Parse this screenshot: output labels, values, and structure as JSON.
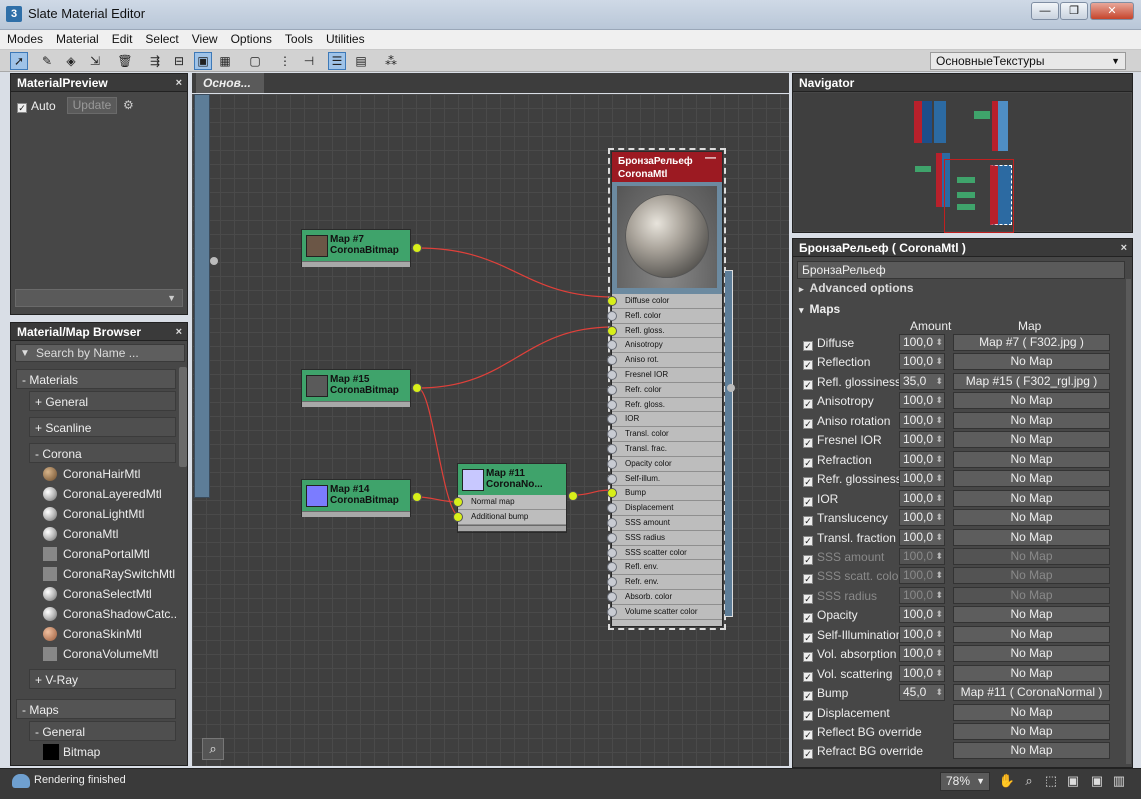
{
  "window": {
    "title": "Slate Material Editor",
    "app_icon": "3",
    "minimize": "—",
    "maximize": "❐",
    "close": "✕"
  },
  "menu": [
    "Modes",
    "Material",
    "Edit",
    "Select",
    "View",
    "Options",
    "Tools",
    "Utilities"
  ],
  "toolbar": {
    "view_select": "ОсновныеТекстуры",
    "view_arrow": "▼"
  },
  "material_preview": {
    "title": "MaterialPreview",
    "close": "×",
    "auto_label": "Auto",
    "update_label": "Update",
    "dropdown_arrow": "▼"
  },
  "browser": {
    "title": "Material/Map Browser",
    "close": "×",
    "search_placeholder": "Search by Name ...",
    "materials_label": "- Materials",
    "general_label": "+ General",
    "scanline_label": "+ Scanline",
    "corona_label": "- Corona",
    "items": [
      "CoronaHairMtl",
      "CoronaLayeredMtl",
      "CoronaLightMtl",
      "CoronaMtl",
      "CoronaPortalMtl",
      "CoronaRaySwitchMtl",
      "CoronaSelectMtl",
      "CoronaShadowCatc..",
      "CoronaSkinMtl",
      "CoronaVolumeMtl"
    ],
    "vray_label": "+ V-Ray",
    "maps_label": "- Maps",
    "maps_general_label": "- General",
    "bitmap_label": "Bitmap"
  },
  "graph": {
    "tab": "Основ...",
    "nodes": {
      "map7": {
        "name": "Map #7",
        "type": "CoronaBitmap",
        "swatch": "#6b5646"
      },
      "map15": {
        "name": "Map #15",
        "type": "CoronaBitmap",
        "swatch": "#5a5a5a"
      },
      "map14": {
        "name": "Map #14",
        "type": "CoronaBitmap",
        "swatch": "#7b7cff"
      },
      "map11": {
        "name": "Map #11",
        "type": "CoronaNo...",
        "swatch": "#c8c8ff",
        "slots": [
          "Normal map",
          "Additional bump"
        ]
      },
      "bronze": {
        "name": "БронзаРельеф",
        "type": "CoronaMtl",
        "minimize": "—",
        "slots": [
          "Diffuse color",
          "Refl. color",
          "Refl. gloss.",
          "Anisotropy",
          "Aniso rot.",
          "Fresnel IOR",
          "Refr. color",
          "Refr. gloss.",
          "IOR",
          "Transl. color",
          "Transl. frac.",
          "Opacity color",
          "Self-illum.",
          "Bump",
          "Displacement",
          "SSS amount",
          "SSS radius",
          "SSS scatter color",
          "Refl. env.",
          "Refr. env.",
          "Absorb. color",
          "Volume scatter color"
        ],
        "connected": [
          0,
          2,
          13
        ]
      }
    }
  },
  "navigator": {
    "title": "Navigator"
  },
  "params": {
    "title": "БронзаРельеф  ( CoronaMtl )",
    "close": "×",
    "name": "БронзаРельеф",
    "advanced_label": "Advanced options",
    "maps_label": "Maps",
    "amount_header": "Amount",
    "map_header": "Map",
    "rows": [
      {
        "label": "Diffuse",
        "amount": "100,0",
        "map": "Map #7 ( F302.jpg )",
        "enabled": true
      },
      {
        "label": "Reflection",
        "amount": "100,0",
        "map": "No Map",
        "enabled": true
      },
      {
        "label": "Refl. glossiness",
        "amount": "35,0",
        "map": "Map #15 ( F302_rgl.jpg )",
        "enabled": true
      },
      {
        "label": "Anisotropy",
        "amount": "100,0",
        "map": "No Map",
        "enabled": true
      },
      {
        "label": "Aniso rotation",
        "amount": "100,0",
        "map": "No Map",
        "enabled": true
      },
      {
        "label": "Fresnel IOR",
        "amount": "100,0",
        "map": "No Map",
        "enabled": true
      },
      {
        "label": "Refraction",
        "amount": "100,0",
        "map": "No Map",
        "enabled": true
      },
      {
        "label": "Refr. glossiness",
        "amount": "100,0",
        "map": "No Map",
        "enabled": true
      },
      {
        "label": "IOR",
        "amount": "100,0",
        "map": "No Map",
        "enabled": true
      },
      {
        "label": "Translucency",
        "amount": "100,0",
        "map": "No Map",
        "enabled": true
      },
      {
        "label": "Transl. fraction",
        "amount": "100,0",
        "map": "No Map",
        "enabled": true
      },
      {
        "label": "SSS amount",
        "amount": "100,0",
        "map": "No Map",
        "enabled": false
      },
      {
        "label": "SSS scatt. color",
        "amount": "100,0",
        "map": "No Map",
        "enabled": false
      },
      {
        "label": "SSS radius",
        "amount": "100,0",
        "map": "No Map",
        "enabled": false
      },
      {
        "label": "Opacity",
        "amount": "100,0",
        "map": "No Map",
        "enabled": true
      },
      {
        "label": "Self-Illumination",
        "amount": "100,0",
        "map": "No Map",
        "enabled": true
      },
      {
        "label": "Vol. absorption",
        "amount": "100,0",
        "map": "No Map",
        "enabled": true
      },
      {
        "label": "Vol. scattering",
        "amount": "100,0",
        "map": "No Map",
        "enabled": true
      },
      {
        "label": "Bump",
        "amount": "45,0",
        "map": "Map #11  ( CoronaNormal )",
        "enabled": true
      },
      {
        "label": "Displacement",
        "amount": "",
        "map": "No Map",
        "enabled": true
      },
      {
        "label": "Reflect BG override",
        "amount": "",
        "map": "No Map",
        "enabled": true
      },
      {
        "label": "Refract BG override",
        "amount": "",
        "map": "No Map",
        "enabled": true
      }
    ]
  },
  "status": {
    "text": "Rendering finished",
    "zoom": "78%"
  },
  "colors": {
    "wire": "#e0403a",
    "port": "#d8ef1a",
    "bitmap_node": "#3fa36b",
    "material_head": "#9c1a22"
  }
}
